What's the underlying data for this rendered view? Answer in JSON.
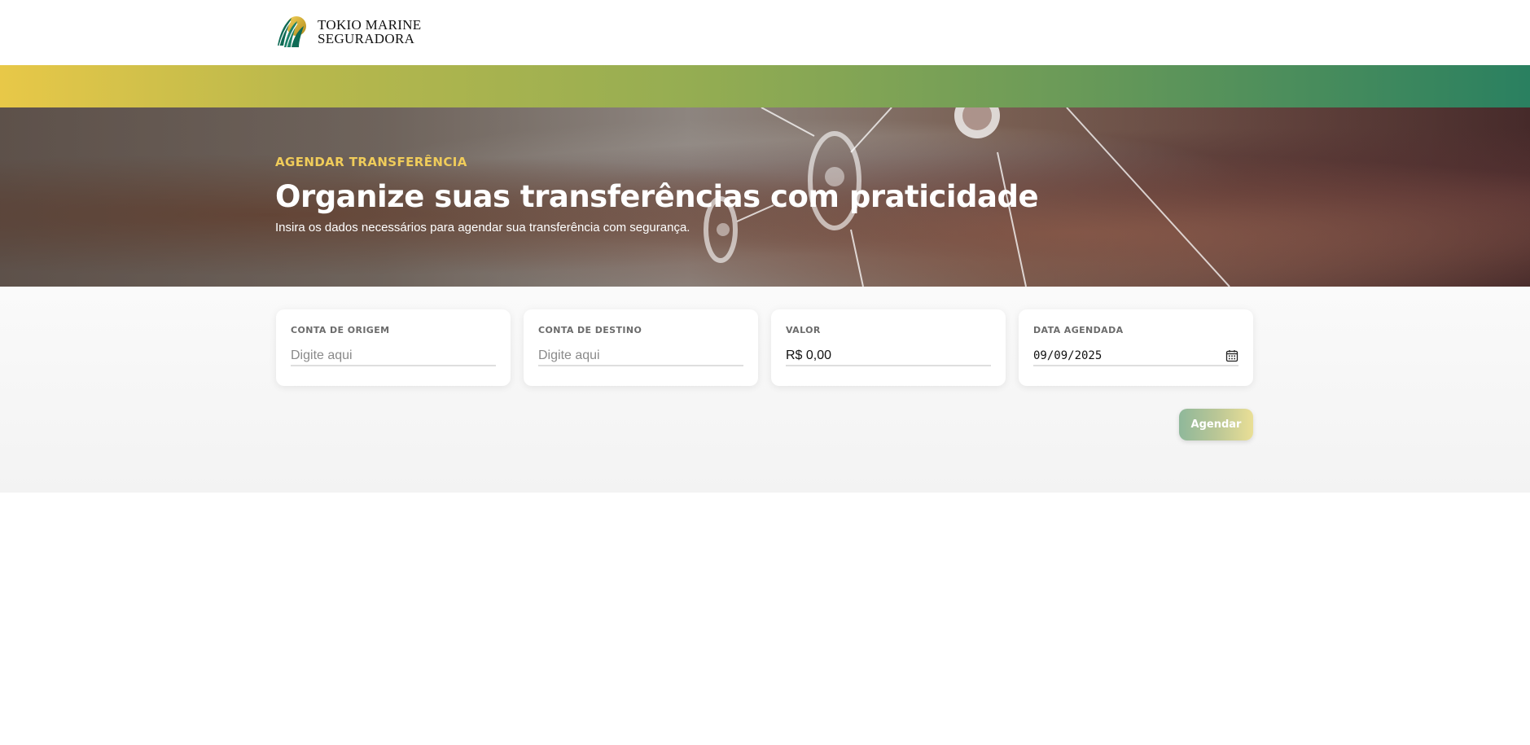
{
  "brand": {
    "name_line1": "TOKIO MARINE",
    "name_line2": "SEGURADORA",
    "logo_icon": "tokio-marine-logo",
    "colors": {
      "gold": "#e8c848",
      "green": "#2a8060",
      "eyebrow": "#f0cc5a"
    }
  },
  "hero": {
    "eyebrow": "AGENDAR TRANSFERÊNCIA",
    "title": "Organize suas transferências com praticidade",
    "subtitle": "Insira os dados necessários para agendar sua transferência com segurança."
  },
  "form": {
    "origin": {
      "label": "CONTA DE ORIGEM",
      "placeholder": "Digite aqui",
      "value": ""
    },
    "destination": {
      "label": "CONTA DE DESTINO",
      "placeholder": "Digite aqui",
      "value": ""
    },
    "amount": {
      "label": "VALOR",
      "value": "R$ 0,00"
    },
    "date": {
      "label": "DATA AGENDADA",
      "value": "09/09/2025",
      "icon": "calendar-icon"
    },
    "submit_label": "Agendar"
  }
}
